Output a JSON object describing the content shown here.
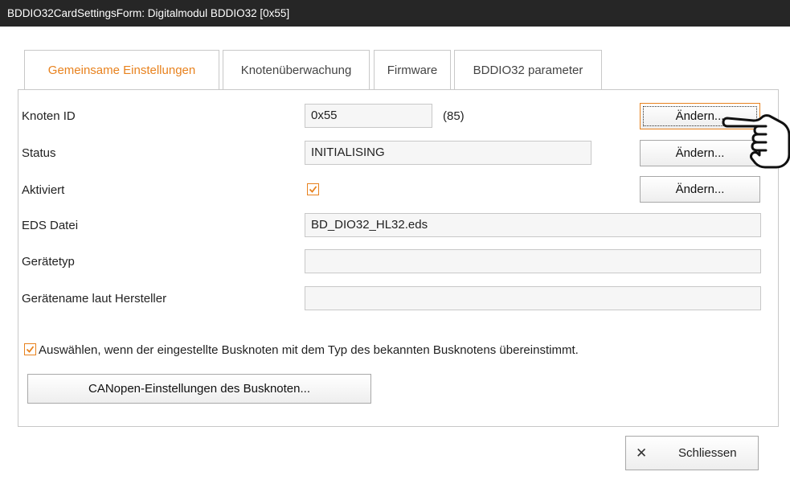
{
  "window": {
    "title": "BDDIO32CardSettingsForm: Digitalmodul BDDIO32 [0x55]"
  },
  "tabs": [
    {
      "label": "Gemeinsame Einstellungen",
      "active": true
    },
    {
      "label": "Knotenüberwachung",
      "active": false
    },
    {
      "label": "Firmware",
      "active": false
    },
    {
      "label": "BDDIO32 parameter",
      "active": false
    }
  ],
  "form": {
    "node_id": {
      "label": "Knoten ID",
      "value": "0x55",
      "decimal": "(85)",
      "button": "Ändern..."
    },
    "status": {
      "label": "Status",
      "value": "INITIALISING",
      "button": "Ändern..."
    },
    "activated": {
      "label": "Aktiviert",
      "checked": true,
      "button": "Ändern..."
    },
    "eds_file": {
      "label": "EDS Datei",
      "value": "BD_DIO32_HL32.eds"
    },
    "device_type": {
      "label": "Gerätetyp",
      "value": ""
    },
    "device_name": {
      "label": "Gerätename laut Hersteller",
      "value": ""
    },
    "match_check": {
      "label": "Auswählen, wenn der eingestellte Busknoten mit dem Typ des bekannten Busknotens übereinstimmt.",
      "checked": true
    },
    "canopen_button": "CANopen-Einstellungen des Busknoten..."
  },
  "footer": {
    "close_label": "Schliessen",
    "close_icon": "close-icon"
  },
  "colors": {
    "accent": "#e8821e",
    "titlebar": "#262626"
  }
}
